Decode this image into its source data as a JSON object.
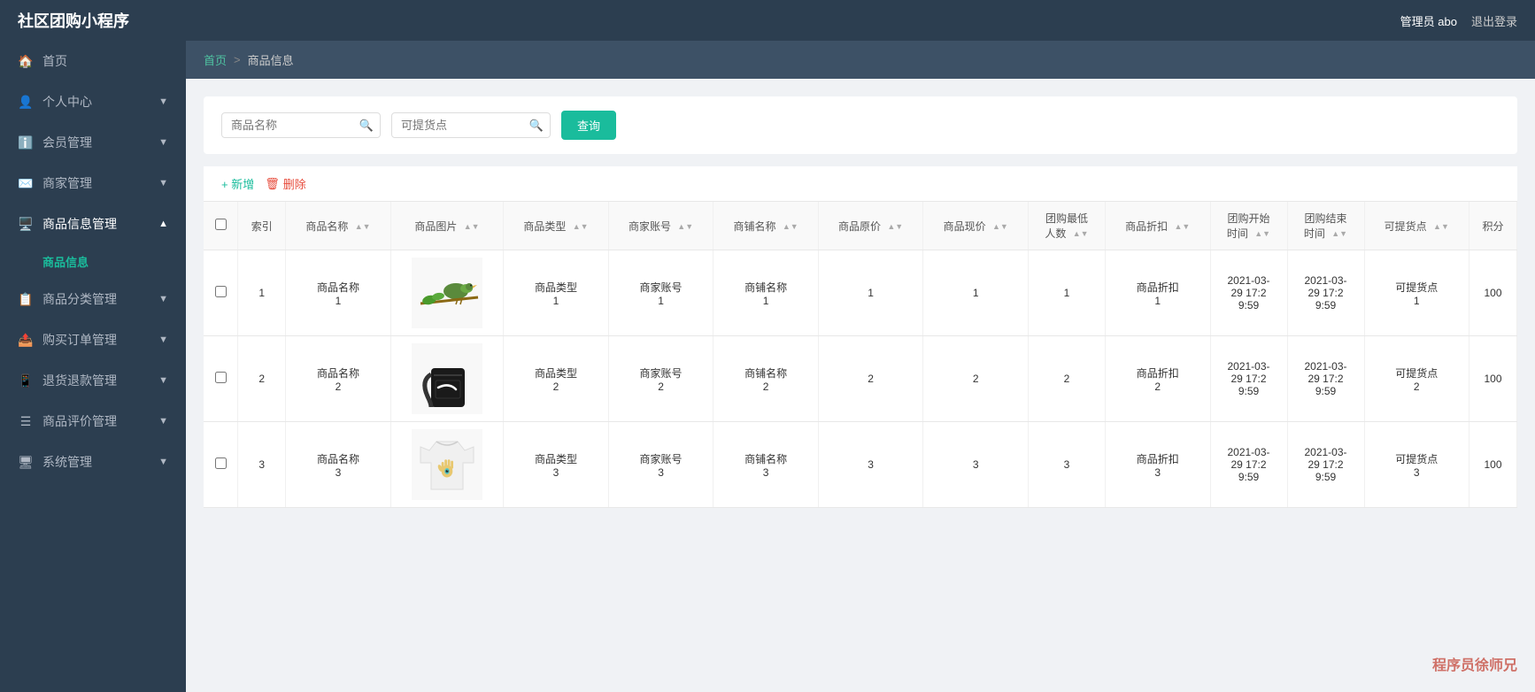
{
  "header": {
    "logo": "社区团购小程序",
    "user_label": "管理员 abo",
    "logout_label": "退出登录"
  },
  "sidebar": {
    "items": [
      {
        "id": "home",
        "icon": "🏠",
        "label": "首页",
        "has_sub": false,
        "active": false
      },
      {
        "id": "profile",
        "icon": "👤",
        "label": "个人中心",
        "has_sub": true,
        "active": false
      },
      {
        "id": "member",
        "icon": "ℹ️",
        "label": "会员管理",
        "has_sub": true,
        "active": false
      },
      {
        "id": "merchant",
        "icon": "✉️",
        "label": "商家管理",
        "has_sub": true,
        "active": false
      },
      {
        "id": "product-mgmt",
        "icon": "🖥️",
        "label": "商品信息管理",
        "has_sub": true,
        "active": true,
        "sub_items": [
          {
            "id": "product-info",
            "label": "商品信息",
            "active": true
          }
        ]
      },
      {
        "id": "category-mgmt",
        "icon": "📋",
        "label": "商品分类管理",
        "has_sub": true,
        "active": false
      },
      {
        "id": "order-mgmt",
        "icon": "📤",
        "label": "购买订单管理",
        "has_sub": true,
        "active": false
      },
      {
        "id": "refund-mgmt",
        "icon": "📱",
        "label": "退货退款管理",
        "has_sub": true,
        "active": false
      },
      {
        "id": "review-mgmt",
        "icon": "☰",
        "label": "商品评价管理",
        "has_sub": true,
        "active": false
      },
      {
        "id": "system-mgmt",
        "icon": "🖥",
        "label": "系统管理",
        "has_sub": true,
        "active": false
      }
    ]
  },
  "breadcrumb": {
    "home_label": "首页",
    "separator": ">",
    "current": "商品信息"
  },
  "search": {
    "product_name_placeholder": "商品名称",
    "pickup_point_placeholder": "可提货点",
    "query_button": "查询"
  },
  "toolbar": {
    "add_label": "+ 新增",
    "delete_label": "删除"
  },
  "table": {
    "columns": [
      "索引",
      "商品名称",
      "商品图片",
      "商品类型",
      "商家账号",
      "商铺名称",
      "商品原价",
      "商品现价",
      "团购最低人数",
      "商品折扣",
      "团购开始时间",
      "团购结束时间",
      "可提货点",
      "积分"
    ],
    "rows": [
      {
        "index": 1,
        "name": "商品名称\n1",
        "img_type": "bird",
        "type": "商品类型\n1",
        "account": "商家账号\n1",
        "shop": "商铺名称\n1",
        "original_price": 1,
        "current_price": 1,
        "min_count": 1,
        "discount": "商品折扣\n1",
        "start_time": "2021-03-\n29 17:2\n9:59",
        "end_time": "2021-03-\n29 17:2\n9:59",
        "pickup": "可提货点\n1",
        "points": 100
      },
      {
        "index": 2,
        "name": "商品名称\n2",
        "img_type": "bag",
        "type": "商品类型\n2",
        "account": "商家账号\n2",
        "shop": "商铺名称\n2",
        "original_price": 2,
        "current_price": 2,
        "min_count": 2,
        "discount": "商品折扣\n2",
        "start_time": "2021-03-\n29 17:2\n9:59",
        "end_time": "2021-03-\n29 17:2\n9:59",
        "pickup": "可提货点\n2",
        "points": 100
      },
      {
        "index": 3,
        "name": "商品名称\n3",
        "img_type": "shirt",
        "type": "商品类型\n3",
        "account": "商家账号\n3",
        "shop": "商铺名称\n3",
        "original_price": 3,
        "current_price": 3,
        "min_count": 3,
        "discount": "商品折扣\n3",
        "start_time": "2021-03-\n29 17:2\n9:59",
        "end_time": "2021-03-\n29 17:2\n9:59",
        "pickup": "可提货点\n3",
        "points": 100
      }
    ]
  },
  "watermark": "程序员徐师兄"
}
